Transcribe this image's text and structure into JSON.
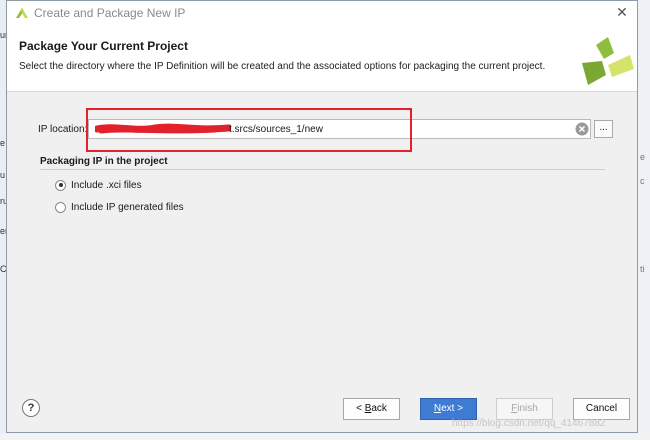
{
  "window": {
    "title": "Create and Package New IP",
    "close_glyph": "✕"
  },
  "header": {
    "title": "Package Your Current Project",
    "description": "Select the directory where the IP Definition will be created and the associated options for packaging the current project."
  },
  "ip_location": {
    "label": "IP location:",
    "value_visible": "t.srcs/sources_1/new",
    "browse_label": "..."
  },
  "packaging": {
    "title": "Packaging IP in the project",
    "options": [
      {
        "label": "Include .xci files",
        "selected": true
      },
      {
        "label": "Include IP generated files",
        "selected": false
      }
    ]
  },
  "footer": {
    "help_label": "?",
    "back_prefix": "< ",
    "back_mnemonic": "B",
    "back_rest": "ack",
    "next_mnemonic": "N",
    "next_rest": "ext >",
    "finish_mnemonic": "F",
    "finish_rest": "inish",
    "cancel_label": "Cancel"
  },
  "watermark": "https://blog.csdn.net/qq_41467882",
  "colors": {
    "primary_button": "#3e7bd3",
    "highlight_box": "#e2212a",
    "logo_green": "#8fbd3e"
  },
  "icons": {
    "app_logo": "vivado-logo-icon",
    "clear": "clear-circle-icon",
    "help": "help-icon"
  }
}
